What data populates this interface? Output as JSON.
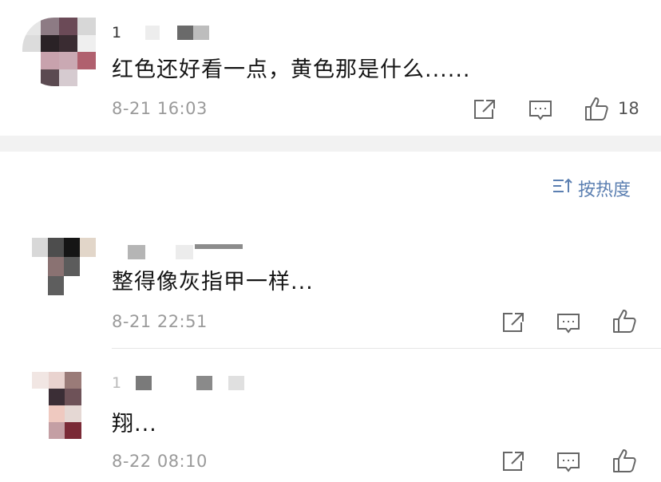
{
  "comments": [
    {
      "name_visible": "1",
      "text": "红色还好看一点，黄色那是什么......",
      "time": "8-21 16:03",
      "likes": "18"
    },
    {
      "name_visible": "",
      "text": "整得像灰指甲一样...",
      "time": "8-21 22:51",
      "likes": ""
    },
    {
      "name_visible": "1",
      "text": "翔...",
      "time": "8-22 08:10",
      "likes": ""
    }
  ],
  "sort": {
    "label": "按热度"
  },
  "icons": {
    "share": "share-icon",
    "reply": "comment-icon",
    "like": "thumbs-up-icon",
    "sort": "sort-icon"
  },
  "colors": {
    "link_blue": "#5b7fb1",
    "time_gray": "#9a9a9a",
    "icon_gray": "#666666"
  }
}
